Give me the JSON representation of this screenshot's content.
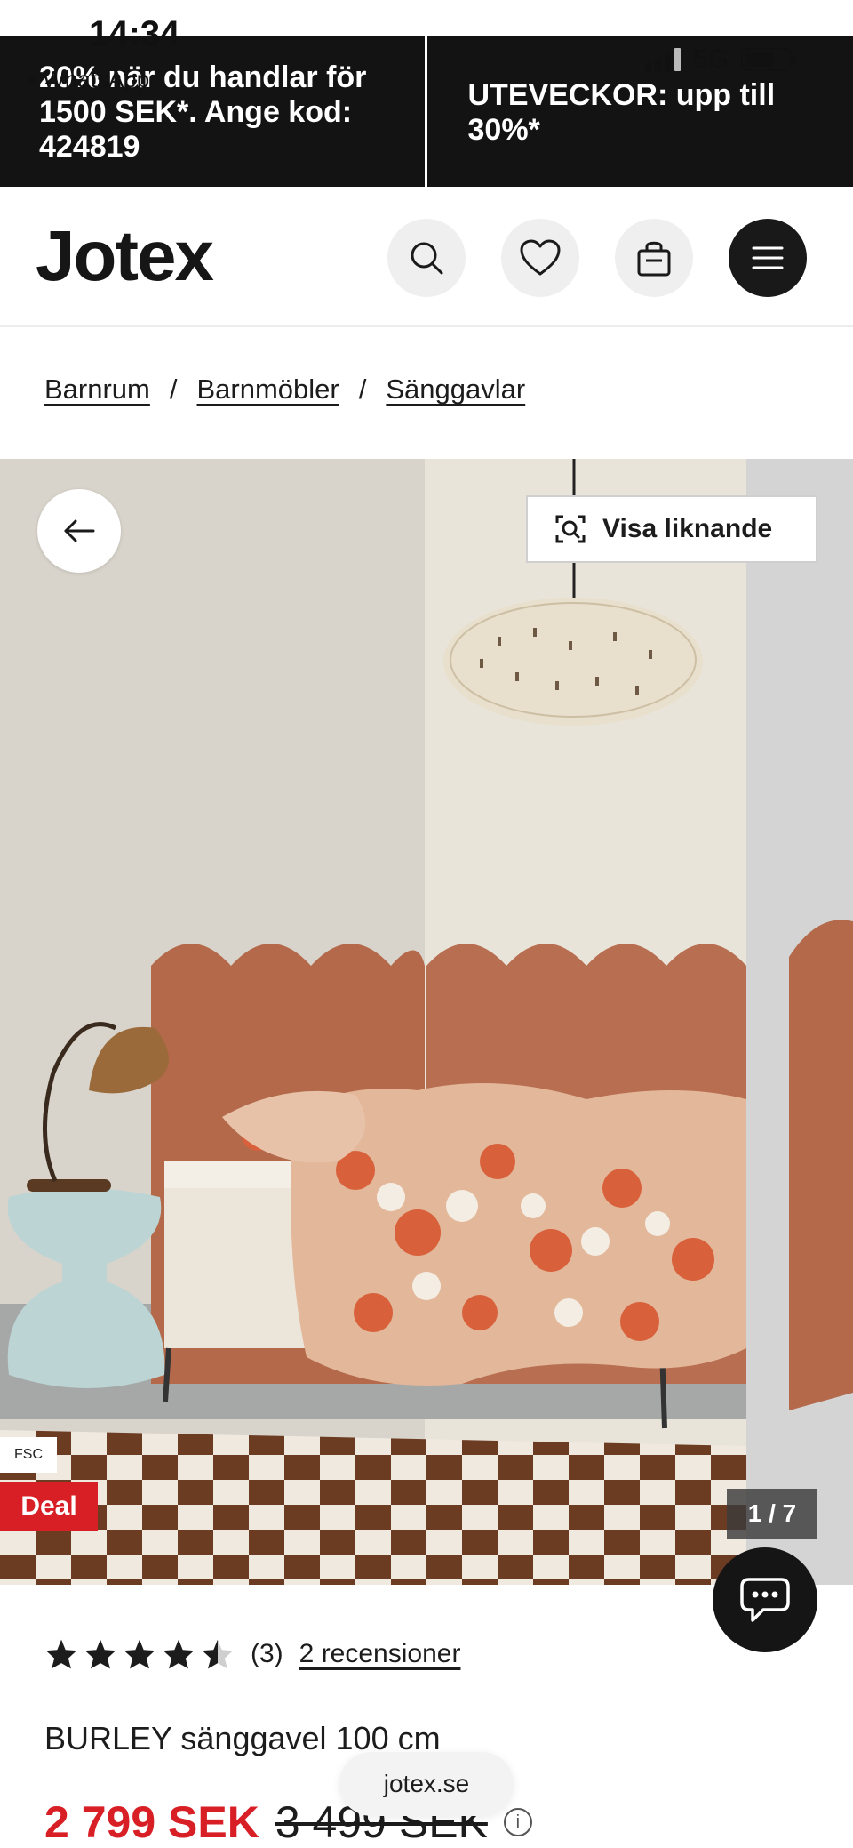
{
  "status_bar": {
    "time": "14:34",
    "back_app": "◂ WhatsApp",
    "network": "5G"
  },
  "promo": {
    "left": "20% när du handlar för 1500 SEK*. Ange kod: 424819",
    "right": "UTEVECKOR: upp till 30%*"
  },
  "header": {
    "logo": "Jotex",
    "icons": [
      "search-icon",
      "heart-icon",
      "bag-icon",
      "menu-icon"
    ]
  },
  "breadcrumb": {
    "items": [
      "Barnrum",
      "Barnmöbler",
      "Sänggavlar"
    ],
    "separator": "/"
  },
  "gallery": {
    "similar_label": "Visa liknande",
    "fsc_label": "FSC",
    "deal_label": "Deal",
    "counter": "1 / 7"
  },
  "product": {
    "rating_value": 4.5,
    "rating_count": "(3)",
    "reviews_link": "2 recensioner",
    "title": "BURLEY sänggavel 100 cm",
    "price_now": "2 799 SEK",
    "price_old": "3 499 SEK"
  },
  "browser": {
    "url": "jotex.se"
  },
  "colors": {
    "accent_red": "#d81f26",
    "dark": "#151515",
    "headboard": "#b4694b"
  }
}
